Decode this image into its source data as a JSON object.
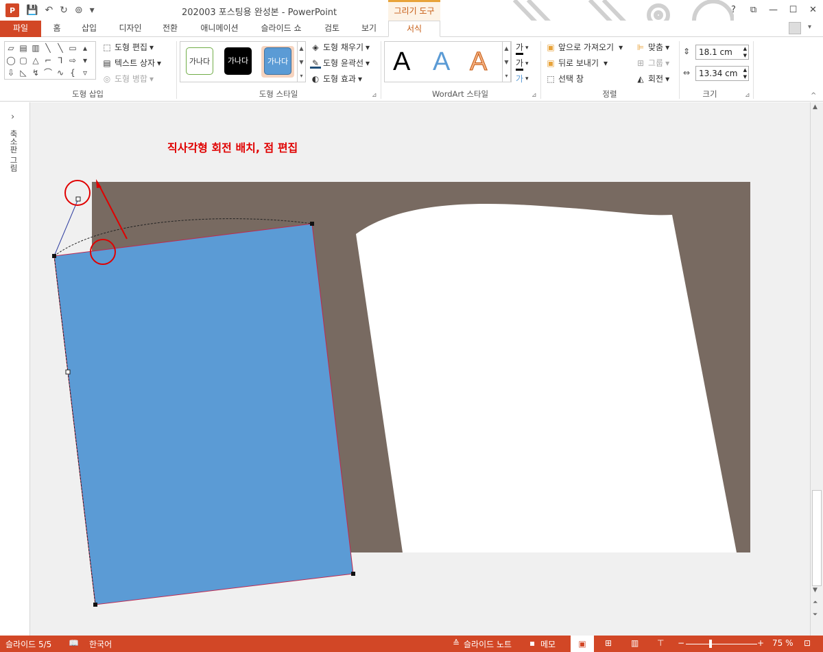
{
  "window": {
    "title": "202003 포스팅용 완성본 - PowerPoint",
    "context_tool": "그리기 도구",
    "help": "?",
    "ribbon_opts": "⧉",
    "minimize": "—",
    "maximize": "☐",
    "close": "✕"
  },
  "qat": {
    "logo": "P",
    "save": "💾",
    "undo": "↶",
    "redo": "↻",
    "present": "⊚",
    "more": "▾"
  },
  "tabs": [
    {
      "label": "파일"
    },
    {
      "label": "홈"
    },
    {
      "label": "삽입"
    },
    {
      "label": "디자인"
    },
    {
      "label": "전환"
    },
    {
      "label": "애니메이션"
    },
    {
      "label": "슬라이드 쇼"
    },
    {
      "label": "검토"
    },
    {
      "label": "보기"
    },
    {
      "label": "서식"
    }
  ],
  "ribbon": {
    "insert_shapes": {
      "label": "도형 삽입",
      "edit_shape": "도형 편집",
      "text_box": "텍스트 상자",
      "merge_shapes": "도형 병합"
    },
    "shape_styles": {
      "label": "도형 스타일",
      "swatch_text": "가나다",
      "fill": "도형 채우기",
      "outline": "도형 윤곽선",
      "effects": "도형 효과"
    },
    "wordart": {
      "label": "WordArt 스타일",
      "letter": "A",
      "text_fill_glyph": "가",
      "text_outline_glyph": "가",
      "text_effect_glyph": "가"
    },
    "arrange": {
      "label": "정렬",
      "bring_forward": "앞으로 가져오기",
      "send_backward": "뒤로 보내기",
      "selection_pane": "선택 창",
      "align": "맞춤",
      "group": "그룹",
      "rotate": "회전"
    },
    "size": {
      "label": "크기",
      "height": "18.1 cm",
      "width": "13.34 cm"
    }
  },
  "left_pane": {
    "label": "축소판 그림",
    "expand": "›"
  },
  "slide": {
    "annotation": "직사각형 회전 배치, 점 편집"
  },
  "status": {
    "slide": "슬라이드 5/5",
    "language": "한국어",
    "notes": "슬라이드 노트",
    "comments": "메모",
    "zoom": "75 %"
  },
  "colors": {
    "accent": "#d24726",
    "shape_fill": "#5b9bd5",
    "slide_bg": "#786a61",
    "annotation": "#e00000"
  }
}
